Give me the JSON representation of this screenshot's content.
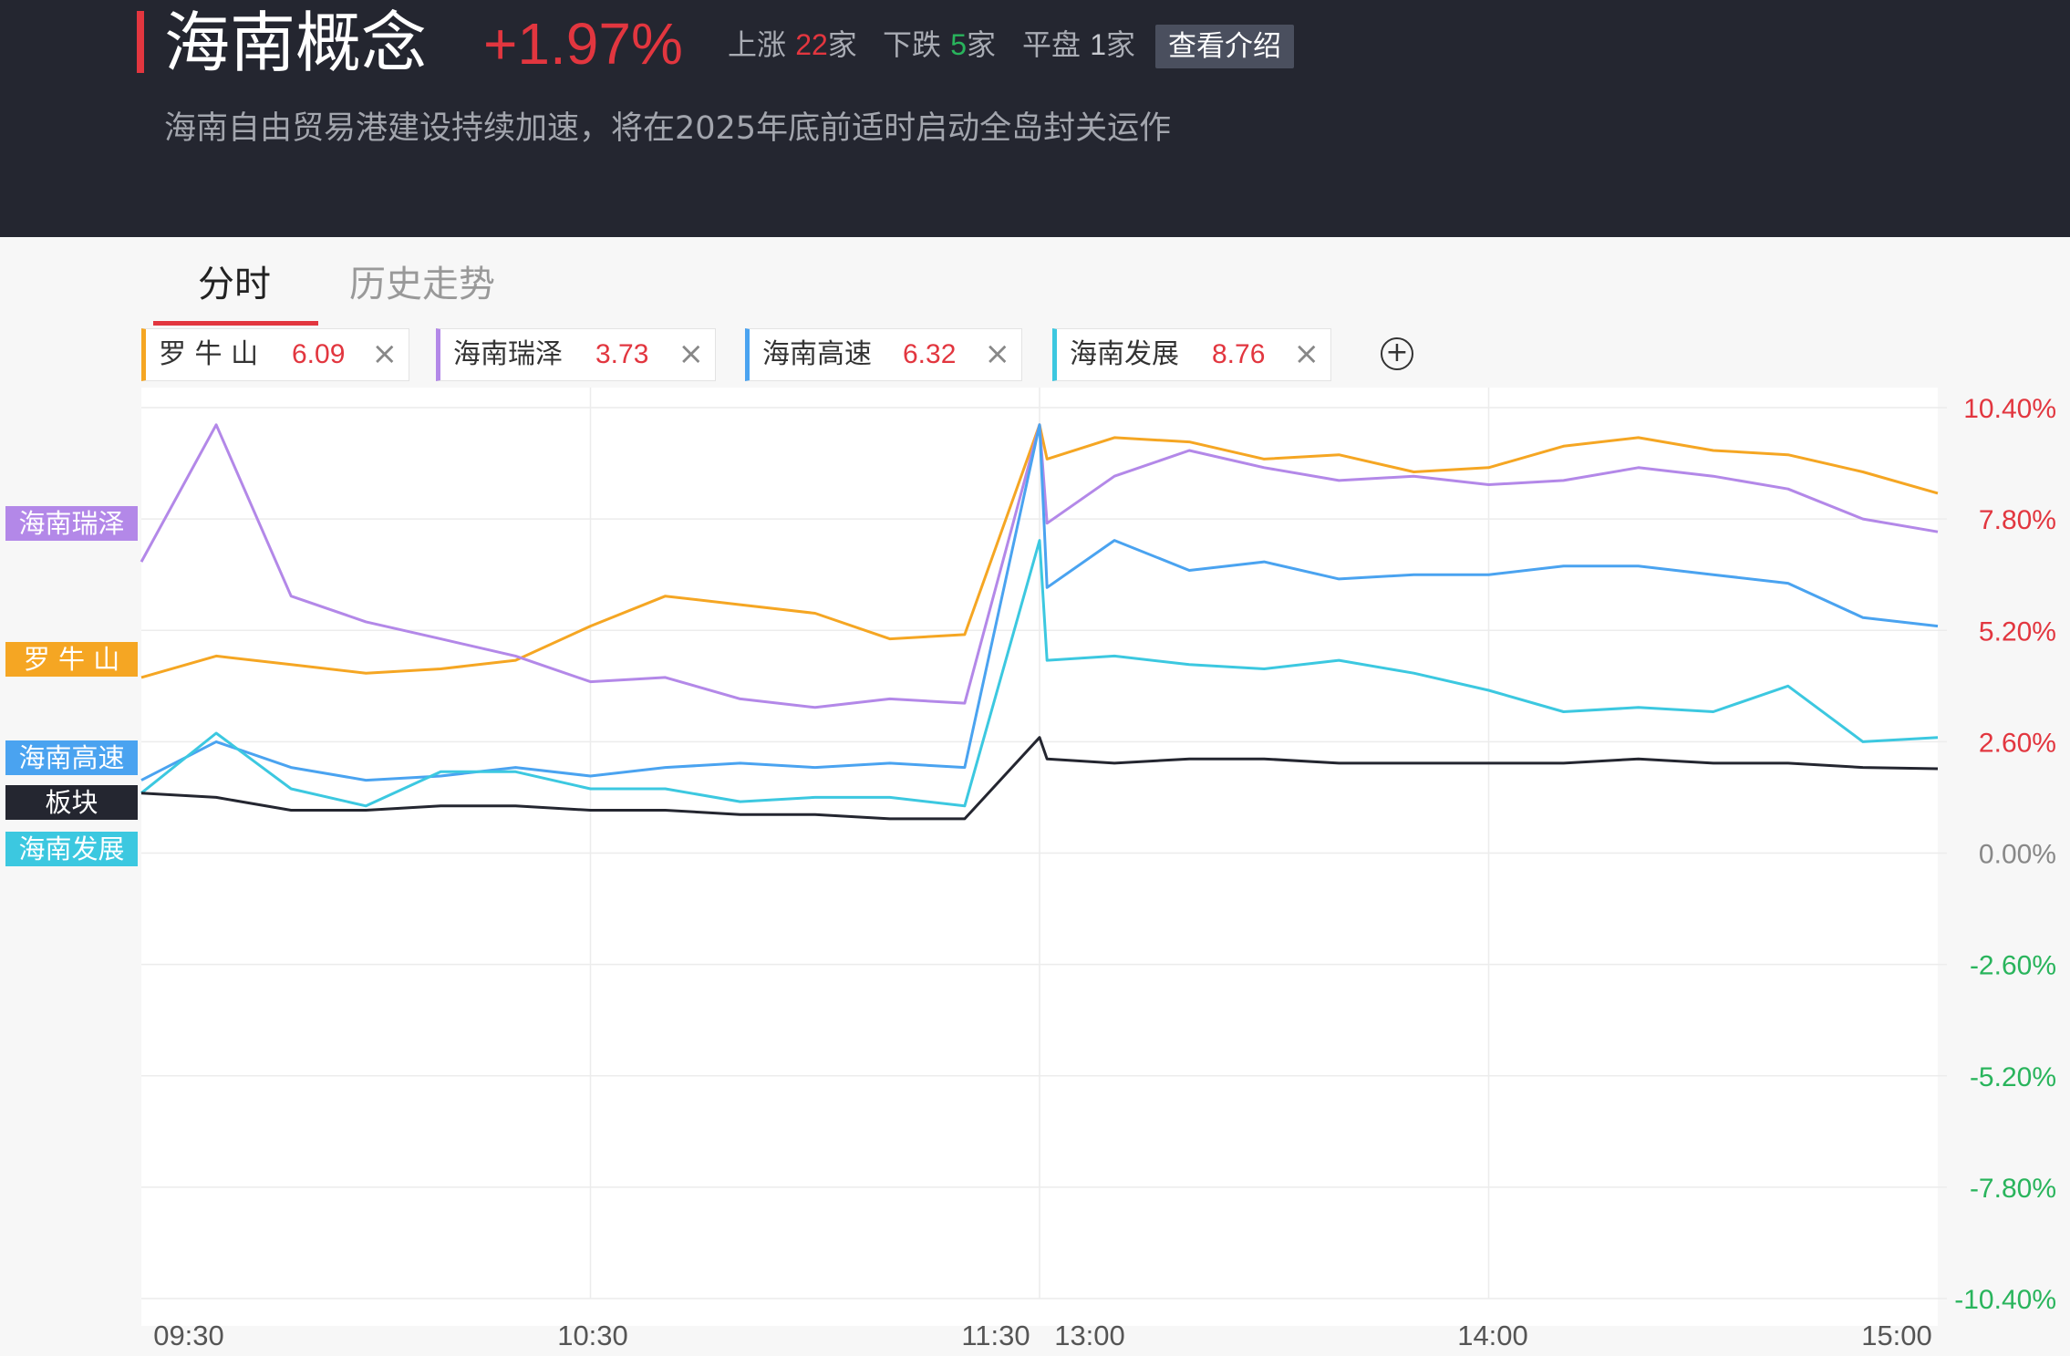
{
  "header": {
    "title": "海南概念",
    "change_pct": "+1.97%",
    "stats": {
      "up_label": "上涨",
      "up_count": "22",
      "up_unit": "家",
      "down_label": "下跌",
      "down_count": "5",
      "down_unit": "家",
      "flat_label": "平盘",
      "flat_count": "1",
      "flat_unit": "家"
    },
    "intro_button": "查看介绍",
    "subtitle": "海南自由贸易港建设持续加速，将在2025年底前适时启动全岛封关运作"
  },
  "tabs": [
    {
      "label": "分时",
      "active": true
    },
    {
      "label": "历史走势",
      "active": false
    }
  ],
  "chips": [
    {
      "name": "罗 牛 山",
      "value": "6.09",
      "color": "#f5a623"
    },
    {
      "name": "海南瑞泽",
      "value": "3.73",
      "color": "#b388e8"
    },
    {
      "name": "海南高速",
      "value": "6.32",
      "color": "#4aa3f0"
    },
    {
      "name": "海南发展",
      "value": "8.76",
      "color": "#3cc8e0"
    }
  ],
  "close_glyph": "×",
  "add_glyph": "+",
  "legend_tags": [
    {
      "label": "海南瑞泽",
      "color": "#b388e8"
    },
    {
      "label": "罗 牛 山",
      "color": "#f5a623"
    },
    {
      "label": "海南高速",
      "color": "#4aa3f0"
    },
    {
      "label": "板块",
      "color": "#242630"
    },
    {
      "label": "海南发展",
      "color": "#3cc8e0"
    }
  ],
  "colors": {
    "up": "#e2363f",
    "down": "#29b45c",
    "neutral": "#888888"
  },
  "chart_data": {
    "type": "line",
    "ylim": [
      -10.4,
      10.4
    ],
    "y_ticks": [
      "10.40%",
      "7.80%",
      "5.20%",
      "2.60%",
      "0.00%",
      "-2.60%",
      "-5.20%",
      "-7.80%",
      "-10.40%"
    ],
    "y_tick_values": [
      10.4,
      7.8,
      5.2,
      2.6,
      0.0,
      -2.6,
      -5.2,
      -7.8,
      -10.4
    ],
    "x_ticks": [
      "09:30",
      "10:30",
      "11:30",
      "13:00",
      "14:00",
      "15:00"
    ],
    "x": [
      "09:30",
      "09:40",
      "09:50",
      "10:00",
      "10:10",
      "10:20",
      "10:30",
      "10:40",
      "10:50",
      "11:00",
      "11:10",
      "11:20",
      "11:30",
      "13:00",
      "13:10",
      "13:20",
      "13:30",
      "13:40",
      "13:50",
      "14:00",
      "14:10",
      "14:20",
      "14:30",
      "14:40",
      "14:50",
      "15:00"
    ],
    "series": [
      {
        "name": "罗 牛 山",
        "color": "#f5a623",
        "values": [
          4.1,
          4.6,
          4.4,
          4.2,
          4.3,
          4.5,
          5.3,
          6.0,
          5.8,
          5.6,
          5.0,
          5.1,
          10.0,
          9.2,
          9.7,
          9.6,
          9.2,
          9.3,
          8.9,
          9.0,
          9.5,
          9.7,
          9.4,
          9.3,
          8.9,
          8.4
        ]
      },
      {
        "name": "海南瑞泽",
        "color": "#b388e8",
        "values": [
          6.8,
          10.0,
          6.0,
          5.4,
          5.0,
          4.6,
          4.0,
          4.1,
          3.6,
          3.4,
          3.6,
          3.5,
          10.0,
          7.7,
          8.8,
          9.4,
          9.0,
          8.7,
          8.8,
          8.6,
          8.7,
          9.0,
          8.8,
          8.5,
          7.8,
          7.5
        ]
      },
      {
        "name": "海南高速",
        "color": "#4aa3f0",
        "values": [
          1.7,
          2.6,
          2.0,
          1.7,
          1.8,
          2.0,
          1.8,
          2.0,
          2.1,
          2.0,
          2.1,
          2.0,
          10.0,
          6.2,
          7.3,
          6.6,
          6.8,
          6.4,
          6.5,
          6.5,
          6.7,
          6.7,
          6.5,
          6.3,
          5.5,
          5.3
        ]
      },
      {
        "name": "海南发展",
        "color": "#3cc8e0",
        "values": [
          1.4,
          2.8,
          1.5,
          1.1,
          1.9,
          1.9,
          1.5,
          1.5,
          1.2,
          1.3,
          1.3,
          1.1,
          7.3,
          4.5,
          4.6,
          4.4,
          4.3,
          4.5,
          4.2,
          3.8,
          3.3,
          3.4,
          3.3,
          3.9,
          2.6,
          2.7
        ]
      },
      {
        "name": "板块",
        "color": "#242630",
        "values": [
          1.4,
          1.3,
          1.0,
          1.0,
          1.1,
          1.1,
          1.0,
          1.0,
          0.9,
          0.9,
          0.8,
          0.8,
          2.7,
          2.2,
          2.1,
          2.2,
          2.2,
          2.1,
          2.1,
          2.1,
          2.1,
          2.2,
          2.1,
          2.1,
          2.0,
          1.97
        ]
      }
    ]
  }
}
